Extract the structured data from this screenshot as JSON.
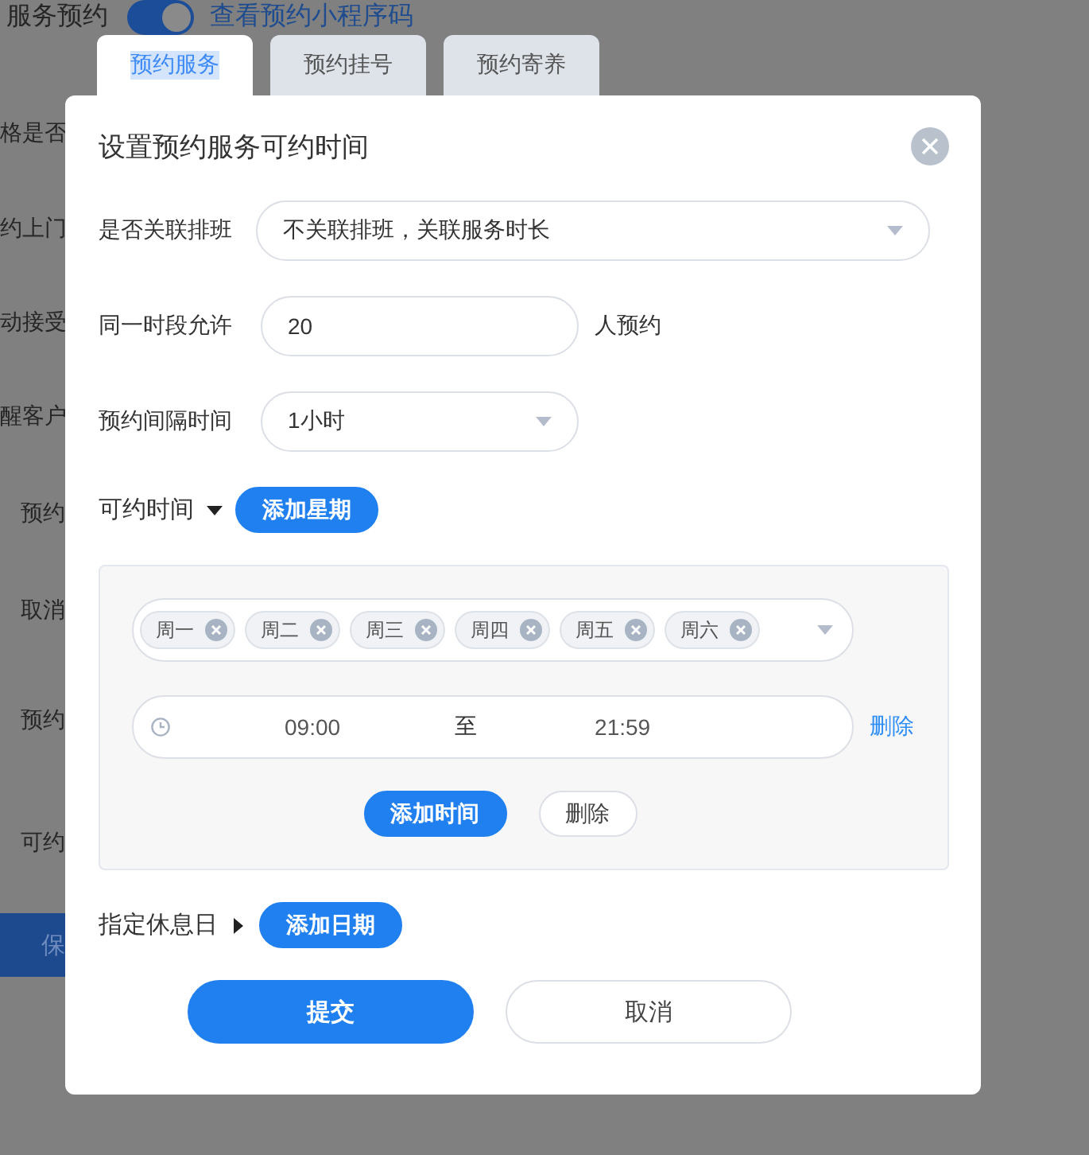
{
  "background": {
    "header_title": "服务预约",
    "toggle": {
      "on": true
    },
    "link": "查看预约小程序码",
    "labels": [
      "格是否",
      "约上门",
      "动接受",
      "醒客户",
      "预约",
      "取消",
      "预约",
      "可约"
    ],
    "save_button": "保"
  },
  "tabs": [
    {
      "label": "预约服务",
      "selected": true
    },
    {
      "label": "预约挂号",
      "selected": false
    },
    {
      "label": "预约寄养",
      "selected": false
    }
  ],
  "dialog": {
    "title": "设置预约服务可约时间",
    "link_schedule": {
      "label": "是否关联排班",
      "value": "不关联排班，关联服务时长"
    },
    "capacity": {
      "label": "同一时段允许",
      "value": "20",
      "suffix": "人预约"
    },
    "interval": {
      "label": "预约间隔时间",
      "value": "1小时"
    },
    "available": {
      "label": "可约时间",
      "expanded": true,
      "button": "添加星期",
      "groups": [
        {
          "days": [
            {
              "label": "周一"
            },
            {
              "label": "周二"
            },
            {
              "label": "周三"
            },
            {
              "label": "周四"
            },
            {
              "label": "周五"
            },
            {
              "label": "周六"
            }
          ],
          "ranges": [
            {
              "start": "09:00",
              "separator": "至",
              "end": "21:59",
              "delete": "删除"
            }
          ],
          "add_button": "添加时间",
          "delete_button": "删除"
        }
      ]
    },
    "rest_days": {
      "label": "指定休息日",
      "expanded": false,
      "button": "添加日期"
    },
    "submit": "提交",
    "cancel": "取消"
  }
}
